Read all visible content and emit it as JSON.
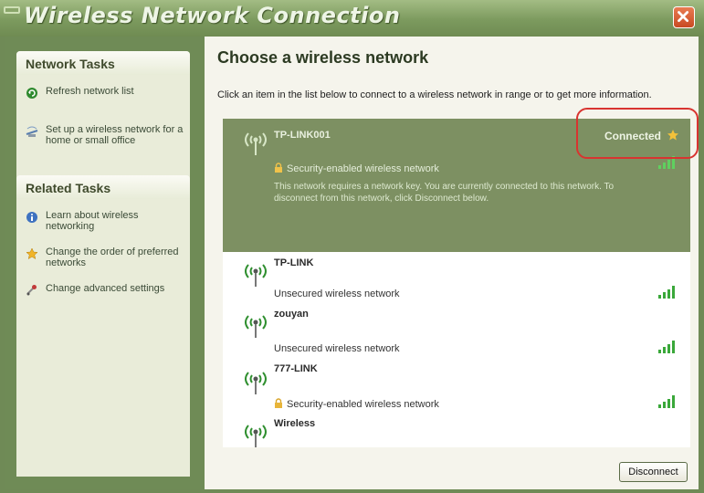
{
  "window": {
    "title": "Wireless Network Connection",
    "close_icon": "close-icon",
    "accent": "#6f8b56"
  },
  "sidebar": {
    "network_tasks": {
      "header": "Network Tasks",
      "items": [
        {
          "label": "Refresh network list",
          "icon": "refresh-icon"
        },
        {
          "label": "Set up a wireless network for a home or small office",
          "icon": "network-setup-icon"
        }
      ]
    },
    "related_tasks": {
      "header": "Related Tasks",
      "items": [
        {
          "label": "Learn about wireless networking",
          "icon": "info-icon"
        },
        {
          "label": "Change the order of preferred networks",
          "icon": "star-icon"
        },
        {
          "label": "Change advanced settings",
          "icon": "settings-icon"
        }
      ]
    }
  },
  "main": {
    "heading": "Choose a wireless network",
    "instructions": "Click an item in the list below to connect to a wireless network in range or to get more information.",
    "networks": [
      {
        "name": "TP-LINK001",
        "status": "Security-enabled wireless network",
        "connection": "Connected",
        "description": "This network requires a network key. You are currently connected to this network. To disconnect from this network, click Disconnect below.",
        "selected": true
      },
      {
        "name": "TP-LINK",
        "status": "Unsecured wireless network"
      },
      {
        "name": "zouyan",
        "status": "Unsecured wireless network"
      },
      {
        "name": "777-LINK",
        "status": "Security-enabled wireless network"
      },
      {
        "name": "Wireless",
        "status": ""
      }
    ],
    "disconnect_label": "Disconnect",
    "highlight_color": "#d83430"
  }
}
